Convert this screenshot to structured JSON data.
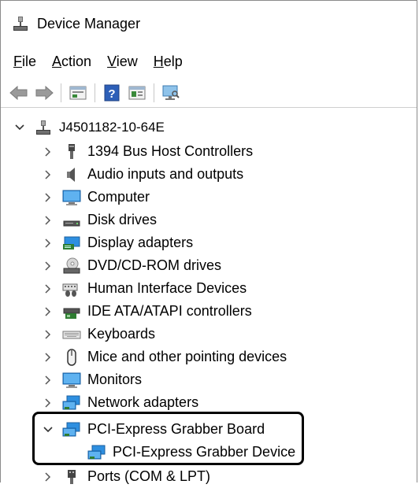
{
  "window": {
    "title": "Device Manager"
  },
  "menu": [
    {
      "acc": "F",
      "rest": "ile"
    },
    {
      "acc": "A",
      "rest": "ction"
    },
    {
      "acc": "V",
      "rest": "iew"
    },
    {
      "acc": "H",
      "rest": "elp"
    }
  ],
  "tree": {
    "root": "J4501182-10-64E",
    "categories": [
      "1394 Bus Host Controllers",
      "Audio inputs and outputs",
      "Computer",
      "Disk drives",
      "Display adapters",
      "DVD/CD-ROM drives",
      "Human Interface Devices",
      "IDE ATA/ATAPI controllers",
      "Keyboards",
      "Mice and other pointing devices",
      "Monitors",
      "Network adapters",
      "PCI-Express Grabber Board",
      "Ports (COM & LPT)"
    ],
    "expanded_child": "PCI-Express Grabber Device"
  }
}
